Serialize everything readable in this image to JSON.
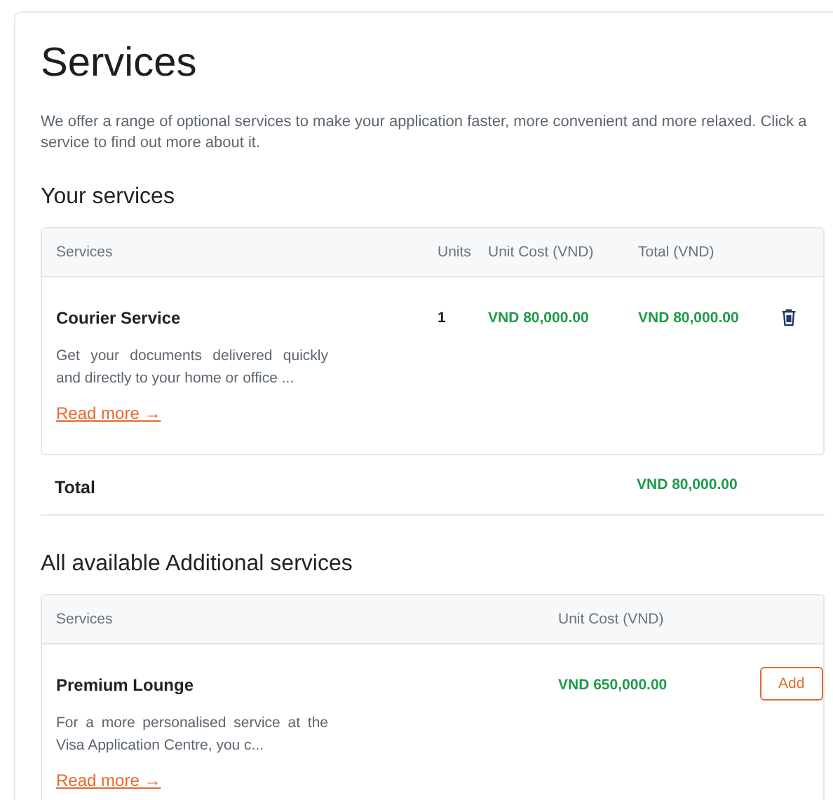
{
  "title": "Services",
  "intro": "We offer a range of optional services to make your application faster, more convenient and more relaxed. Click a service to find out more about it.",
  "your_services": {
    "heading": "Your services",
    "columns": [
      "Services",
      "Units",
      "Unit Cost (VND)",
      "Total (VND)"
    ],
    "rows": [
      {
        "name": "Courier Service",
        "description": "Get your documents delivered quickly and directly to your home or office ...",
        "link": "Read more →",
        "units": "1",
        "unit_cost": "VND 80,000.00",
        "total": "VND 80,000.00"
      }
    ],
    "total_label": "Total",
    "total_value": "VND 80,000.00"
  },
  "additional_services": {
    "heading": "All available Additional services",
    "columns": [
      "Services",
      "Unit Cost (VND)"
    ],
    "rows": [
      {
        "name": "Premium Lounge",
        "description": "For a more personalised service at the Visa Application Centre, you c...",
        "link": "Read more →",
        "unit_cost": "VND 650,000.00",
        "button": "Add"
      }
    ]
  }
}
